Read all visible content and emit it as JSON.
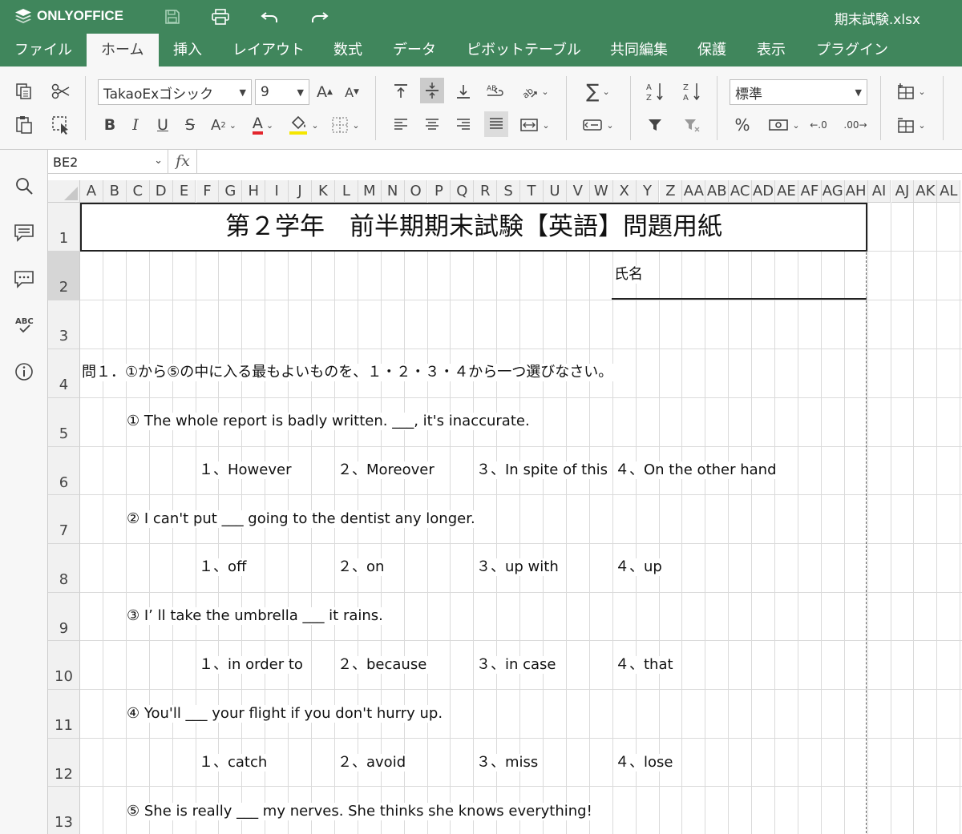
{
  "app": {
    "brand": "ONLYOFFICE",
    "doc_title": "期末試験.xlsx",
    "accent": "#40865c"
  },
  "tabs": [
    {
      "label": "ファイル"
    },
    {
      "label": "ホーム"
    },
    {
      "label": "挿入"
    },
    {
      "label": "レイアウト"
    },
    {
      "label": "数式"
    },
    {
      "label": "データ"
    },
    {
      "label": "ピボットテーブル"
    },
    {
      "label": "共同編集"
    },
    {
      "label": "保護"
    },
    {
      "label": "表示"
    },
    {
      "label": "プラグイン"
    }
  ],
  "toolbar": {
    "font_name": "TakaoExゴシック",
    "font_size": "9",
    "number_format": "標準",
    "increase_font": "A",
    "decrease_font": "A",
    "bold": "B",
    "italic": "I",
    "underline": "U",
    "strike": "S",
    "subscript": "A",
    "font_color": "A",
    "percent": "%",
    "decimal_inc": ".0",
    "decimal_dec": ".00"
  },
  "formula_bar": {
    "cell_ref": "BE2",
    "fx": "fx",
    "value": ""
  },
  "columns": [
    "A",
    "B",
    "C",
    "D",
    "E",
    "F",
    "G",
    "H",
    "I",
    "J",
    "K",
    "L",
    "M",
    "N",
    "O",
    "P",
    "Q",
    "R",
    "S",
    "T",
    "U",
    "V",
    "W",
    "X",
    "Y",
    "Z",
    "AA",
    "AB",
    "AC",
    "AD",
    "AE",
    "AF",
    "AG",
    "AH",
    "AI",
    "AJ",
    "AK",
    "AL"
  ],
  "rows": [
    "1",
    "2",
    "3",
    "4",
    "5",
    "6",
    "7",
    "8",
    "9",
    "10",
    "11",
    "12",
    "13"
  ],
  "selected_row": "2",
  "sheet": {
    "title": "第２学年　前半期期末試験【英語】問題用紙",
    "name_label": "氏名",
    "q_header": "問１．①から⑤の中に入る最もよいものを、１・２・３・４から一つ選びなさい。",
    "questions": [
      {
        "text": "① The whole report is badly written. ___, it's inaccurate.",
        "options": [
          "１、However",
          "２、Moreover",
          "３、In spite of this",
          "４、On the other hand"
        ]
      },
      {
        "text": "② I can't put ___ going to the dentist any longer.",
        "options": [
          "１、off",
          "２、on",
          "３、up with",
          "４、up"
        ]
      },
      {
        "text": "③ I’ ll take the umbrella ___ it rains.",
        "options": [
          "１、in order to",
          "２、because",
          "３、in case",
          "４、that"
        ]
      },
      {
        "text": "④ You'll ___ your flight if you don't hurry up.",
        "options": [
          "１、catch",
          "２、avoid",
          "３、miss",
          "４、lose"
        ]
      },
      {
        "text": "⑤ She is really ___ my nerves. She thinks she knows everything!"
      }
    ]
  }
}
